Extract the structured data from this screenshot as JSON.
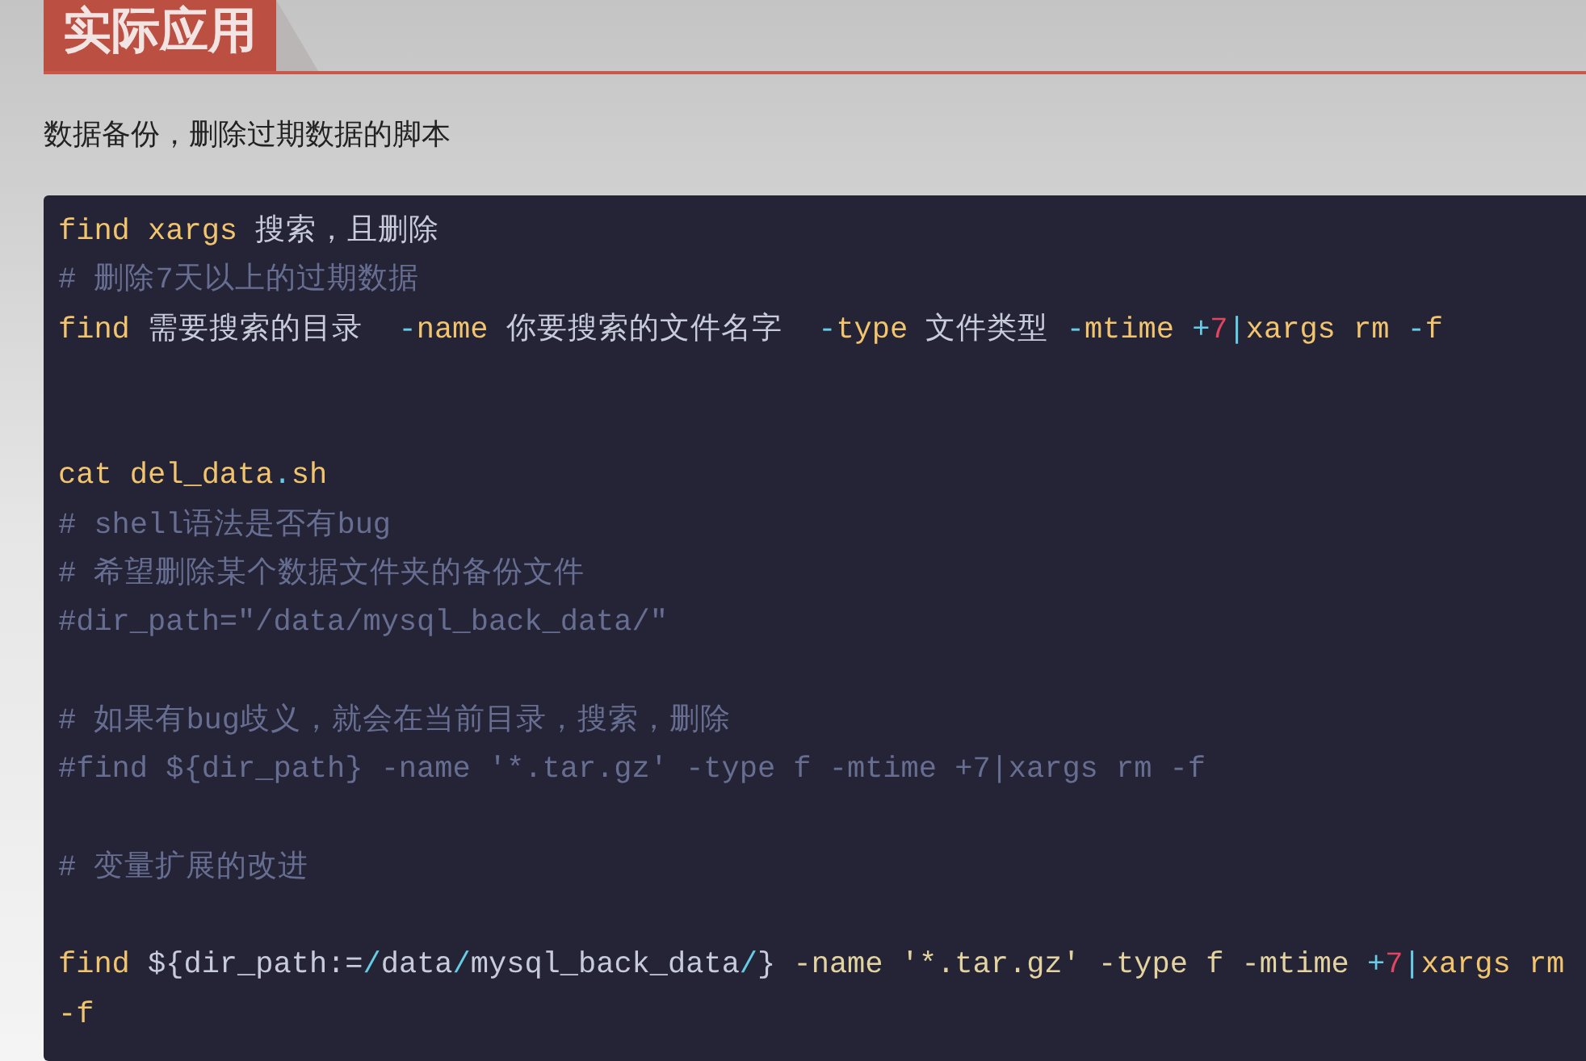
{
  "heading": "实际应用",
  "intro": "数据备份，删除过期数据的脚本",
  "code_lines": [
    {
      "kind": "code",
      "tokens": [
        {
          "text": "find xargs",
          "kind": "command"
        },
        {
          "text": " 搜索，且删除",
          "kind": "plain"
        }
      ]
    },
    {
      "kind": "code",
      "tokens": [
        {
          "text": "# 删除7天以上的过期数据",
          "kind": "comment"
        }
      ]
    },
    {
      "kind": "code",
      "tokens": [
        {
          "text": "find",
          "kind": "command"
        },
        {
          "text": " 需要搜索的目录  ",
          "kind": "plain"
        },
        {
          "text": "-",
          "kind": "operator"
        },
        {
          "text": "name",
          "kind": "command"
        },
        {
          "text": " 你要搜索的文件名字  ",
          "kind": "plain"
        },
        {
          "text": "-",
          "kind": "operator"
        },
        {
          "text": "type",
          "kind": "command"
        },
        {
          "text": " 文件类型 ",
          "kind": "plain"
        },
        {
          "text": "-",
          "kind": "operator"
        },
        {
          "text": "mtime ",
          "kind": "command"
        },
        {
          "text": "+",
          "kind": "operator"
        },
        {
          "text": "7",
          "kind": "number"
        },
        {
          "text": "|",
          "kind": "operator"
        },
        {
          "text": "xargs rm ",
          "kind": "command"
        },
        {
          "text": "-",
          "kind": "operator"
        },
        {
          "text": "f",
          "kind": "command"
        }
      ]
    },
    {
      "kind": "blank"
    },
    {
      "kind": "blank"
    },
    {
      "kind": "code",
      "tokens": [
        {
          "text": "cat del_data",
          "kind": "command"
        },
        {
          "text": ".",
          "kind": "operator"
        },
        {
          "text": "sh",
          "kind": "command"
        }
      ]
    },
    {
      "kind": "code",
      "tokens": [
        {
          "text": "# shell语法是否有bug",
          "kind": "comment"
        }
      ]
    },
    {
      "kind": "code",
      "tokens": [
        {
          "text": "# 希望删除某个数据文件夹的备份文件",
          "kind": "comment"
        }
      ]
    },
    {
      "kind": "code",
      "tokens": [
        {
          "text": "#dir_path=\"/data/mysql_back_data/\"",
          "kind": "comment"
        }
      ]
    },
    {
      "kind": "blank"
    },
    {
      "kind": "code",
      "tokens": [
        {
          "text": "# 如果有bug歧义，就会在当前目录，搜索，删除",
          "kind": "comment"
        }
      ]
    },
    {
      "kind": "code",
      "tokens": [
        {
          "text": "#find ${dir_path} -name '*.tar.gz' -type f -mtime +7|xargs rm -f",
          "kind": "comment"
        }
      ]
    },
    {
      "kind": "blank"
    },
    {
      "kind": "code",
      "tokens": [
        {
          "text": "# 变量扩展的改进",
          "kind": "comment"
        }
      ]
    },
    {
      "kind": "blank"
    },
    {
      "kind": "code",
      "tokens": [
        {
          "text": "find",
          "kind": "command"
        },
        {
          "text": " ${dir_path:=",
          "kind": "plain"
        },
        {
          "text": "/",
          "kind": "operator"
        },
        {
          "text": "data",
          "kind": "plain"
        },
        {
          "text": "/",
          "kind": "operator"
        },
        {
          "text": "mysql_back_data",
          "kind": "plain"
        },
        {
          "text": "/",
          "kind": "operator"
        },
        {
          "text": "} ",
          "kind": "plain"
        },
        {
          "text": "-name '*.tar.gz' -type f -mtime ",
          "kind": "string"
        },
        {
          "text": "+",
          "kind": "operator"
        },
        {
          "text": "7",
          "kind": "number"
        },
        {
          "text": "|",
          "kind": "operator"
        },
        {
          "text": "xargs rm -f",
          "kind": "command"
        }
      ]
    }
  ]
}
